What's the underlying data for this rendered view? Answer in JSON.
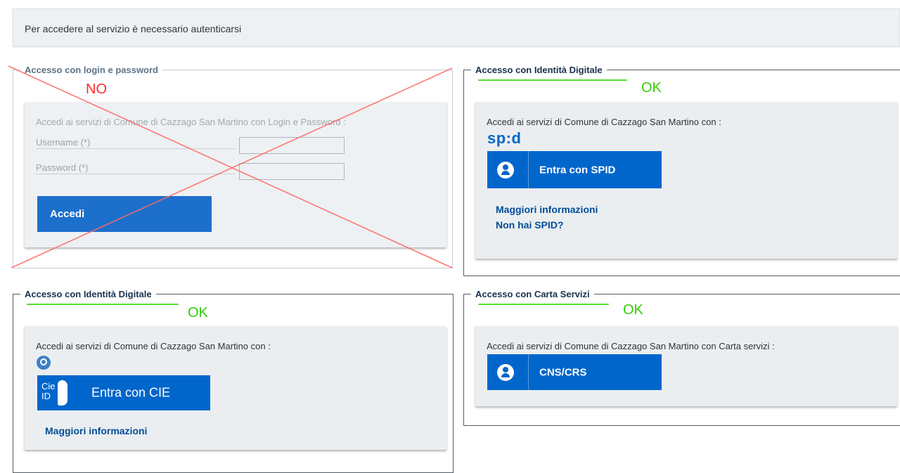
{
  "notice": "Per accedere al servizio è necessario autenticarsi",
  "login": {
    "legend": "Accesso con login e password",
    "status": "NO",
    "intro": "Accedi ai servizi di Comune di Cazzago San Martino con Login e Password :",
    "username_label": "Username (*)",
    "password_label": "Password (*)",
    "submit_label": "Accedi"
  },
  "spid": {
    "legend": "Accesso con Identità Digitale",
    "status": "OK",
    "intro": "Accedi ai servizi di Comune di Cazzago San Martino con :",
    "logo_text": "sp:d",
    "button_label": "Entra con SPID",
    "link_more": "Maggiori informazioni",
    "link_no_spid": "Non hai SPID?"
  },
  "cie": {
    "legend": "Accesso con Identità Digitale",
    "status": "OK",
    "intro": "Accedi ai servizi di Comune di Cazzago San Martino con :",
    "badge_text": "Cie\nID",
    "button_label": "Entra con CIE",
    "link_more": "Maggiori informazioni"
  },
  "cns": {
    "legend": "Accesso con Carta Servizi",
    "status": "OK",
    "intro": "Accedi ai servizi di Comune di Cazzago San Martino con Carta servizi :",
    "button_label": "CNS/CRS"
  },
  "colors": {
    "primary": "#0066cc",
    "link": "#004d99",
    "ok": "#33cc00",
    "no": "#ff2a2a",
    "panel": "#ebeef0"
  },
  "icons": {
    "person": "user-icon",
    "cross": "cross-out-mark",
    "cie_badge": "cie-id-icon",
    "cie_small": "cie-mini-icon"
  }
}
